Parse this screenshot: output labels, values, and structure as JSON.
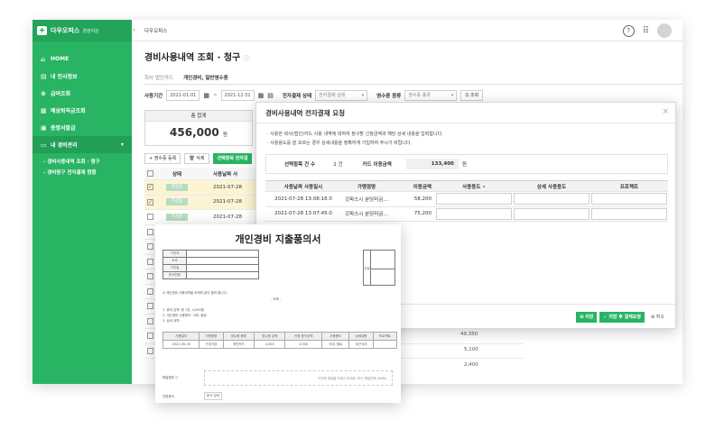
{
  "sidebar": {
    "brand": "다우오피스",
    "brand_sub": "경영지원",
    "items": [
      {
        "label": "HOME",
        "icon": "home-icon",
        "glyph": "⌂"
      },
      {
        "label": "내 인사정보",
        "icon": "id-card-icon",
        "glyph": "▤"
      },
      {
        "label": "급여조회",
        "icon": "coin-icon",
        "glyph": "⊚"
      },
      {
        "label": "예상퇴직금조회",
        "icon": "calculator-icon",
        "glyph": "▦"
      },
      {
        "label": "증명서발급",
        "icon": "certificate-icon",
        "glyph": "▣"
      },
      {
        "label": "내 경비관리",
        "icon": "receipt-icon",
        "glyph": "▭"
      }
    ],
    "subitems": [
      "경비사용내역 조회 · 청구",
      "경비청구 전자결재 현황"
    ]
  },
  "topbar": {
    "breadcrumb": "다우오피스",
    "help_glyph": "?",
    "apps_glyph": "⠿"
  },
  "page": {
    "title": "경비사용내역 조회 · 청구",
    "info_glyph": "ⓘ",
    "tabs": [
      "회사 법인카드",
      "개인경비, 일반영수증"
    ],
    "filter": {
      "period_label": "사용기간",
      "start": "2021-01-01",
      "tilde": "~",
      "end": "2021-12-31",
      "approval_label": "전자결재 상태",
      "approval_placeholder": "전자결재 상태",
      "receipt_label": "영수증 종류",
      "receipt_placeholder": "영수증 종류",
      "search": "Q 조회"
    },
    "summary": {
      "label": "총 합계",
      "amount": "456,000",
      "unit": "원"
    },
    "actions": {
      "add": "+ 영수증 등록",
      "delete": "🗑 삭제",
      "selected": "선택항목 전자결"
    },
    "grid": {
      "headers": [
        "상태",
        "사용날짜 사"
      ],
      "rows": [
        {
          "checked": true,
          "status": "작성중",
          "date": "2021-07-28"
        },
        {
          "checked": true,
          "status": "작성중",
          "date": "2021-07-28"
        },
        {
          "checked": false,
          "status": "작성중",
          "date": "2021-07-28"
        },
        {
          "checked": false,
          "status": "",
          "date": ""
        },
        {
          "checked": false,
          "status": "",
          "date": ""
        },
        {
          "checked": false,
          "status": "",
          "date": ""
        },
        {
          "checked": false,
          "status": "",
          "date": ""
        },
        {
          "checked": false,
          "status": "",
          "date": ""
        },
        {
          "checked": false,
          "status": "",
          "date": ""
        },
        {
          "checked": false,
          "status": "",
          "date": ""
        },
        {
          "checked": false,
          "status": "",
          "date": ""
        },
        {
          "checked": false,
          "status": "",
          "date": ""
        }
      ],
      "amounts": [
        "49,350",
        "5,100",
        "2,400"
      ]
    }
  },
  "modal": {
    "title": "경비사용내역 전자결재 요청",
    "close": "×",
    "desc": [
      "· 사용한 회사(법인)카드 사용 내역에 대하여 청구할 신청금액과 해당 상세 내용을 입력합니다.",
      "· 사용용도를 잘 모르는 경우 상세내용을 정확하게 기입하여 주시기 바랍니다."
    ],
    "count_label": "선택항목 건 수",
    "count_value": "2 건",
    "card_label": "카드 이용금액",
    "card_amount": "133,400",
    "card_unit": "원",
    "headers": [
      "사용날짜 사용일시",
      "가맹점명",
      "이용금액",
      "사용용도",
      "상세 사용용도",
      "프로젝트"
    ],
    "rows": [
      [
        "2021-07-28 13:08:16.0",
        "갓파스시 분당미금…",
        "58,200"
      ],
      [
        "2021-07-28 13:07:45.0",
        "갓파스시 분당미금…",
        "75,200"
      ]
    ],
    "buttons": {
      "save": "저장",
      "save_request": "저장 후 결재요청",
      "cancel": "취소"
    }
  },
  "doc": {
    "title": "개인경비 지출품의서",
    "fields": [
      "기안자",
      "소속",
      "기안일",
      "문서번호"
    ],
    "sign_label": "신청",
    "note": "※ 개인경비 사용내역을 아래와 같이 품의 합니다.",
    "mid": "- 아래 -",
    "lines": [
      "1. 총비 금액: 총 1건, 4,000원",
      "2. 개인경비 사용용도: 식대, 음료",
      "3. 상세 내역 :"
    ],
    "item_headers": [
      "사용일자",
      "가맹점명",
      "영수증 종류",
      "영수증 금액",
      "신청 청구금액",
      "사용용도",
      "상세내용",
      "프로젝트"
    ],
    "item_row": [
      "2021-06-16",
      "구내식당",
      "개인카드",
      "4,000",
      "4,000",
      "식대, 음료",
      "야근식대",
      ""
    ],
    "attach_label": "파일첨부 ⓘ",
    "attach_hint": "이곳에 파일을 드래그 하세요. 또는 파일선택 (0MB)",
    "ref_label": "관련문서",
    "ref_button": "문서 검색"
  }
}
